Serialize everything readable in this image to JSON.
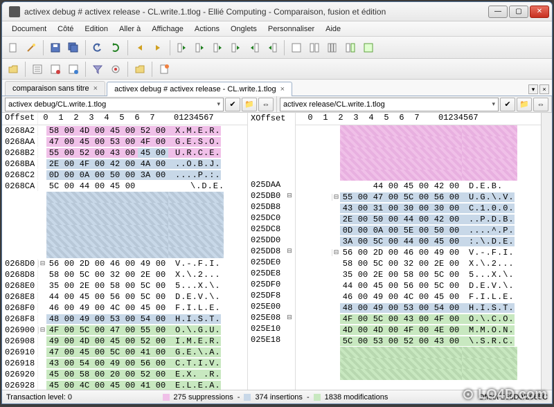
{
  "window": {
    "title": "activex debug # activex release - CL.write.1.tlog - Ellié Computing - Comparaison, fusion et édition",
    "min": "—",
    "max": "▢",
    "close": "✕"
  },
  "menu": [
    "Document",
    "Côté",
    "Edition",
    "Aller à",
    "Affichage",
    "Actions",
    "Onglets",
    "Personnaliser",
    "Aide"
  ],
  "tabs": [
    {
      "label": "comparaison sans titre",
      "active": false
    },
    {
      "label": "activex debug # activex release - CL.write.1.tlog",
      "active": true
    }
  ],
  "files": {
    "left": "activex debug/CL.write.1.tlog",
    "right": "activex release/CL.write.1.tlog"
  },
  "header_bytes": [
    "0",
    "1",
    "2",
    "3",
    "4",
    "5",
    "6",
    "7"
  ],
  "header_ascii": "01234567",
  "header_offset": "Offset",
  "header_xoffset": "XOffset",
  "status": {
    "transaction": "Transaction level: 0",
    "supp": "275 suppressions",
    "ins": "374 insertions",
    "mod": "1838 modifications",
    "offset": "Offset 268D0/2065C"
  },
  "left_rows": [
    {
      "ofs": "0268A2",
      "b": [
        "58",
        "00",
        "4D",
        "00",
        "45",
        "00",
        "52",
        "00"
      ],
      "a": "X.M.E.R.",
      "cls": "bg-pink"
    },
    {
      "ofs": "0268AA",
      "b": [
        "47",
        "00",
        "45",
        "00",
        "53",
        "00",
        "4F",
        "00"
      ],
      "a": "G.E.S.O.",
      "cls": "bg-pink"
    },
    {
      "ofs": "0268B2",
      "b": [
        "55",
        "00",
        "52",
        "00",
        "43",
        "00",
        "45",
        "00"
      ],
      "a": "U.R.C.E.",
      "cls": "bg-pink",
      "partial_blue": true
    },
    {
      "ofs": "0268BA",
      "b": [
        "2E",
        "00",
        "4F",
        "00",
        "42",
        "00",
        "4A",
        "00"
      ],
      "a": "..O.B.J.",
      "cls": "bg-blue"
    },
    {
      "ofs": "0268C2",
      "b": [
        "0D",
        "00",
        "0A",
        "00",
        "50",
        "00",
        "3A",
        "00"
      ],
      "a": "....P.:.",
      "cls": "bg-blue"
    },
    {
      "ofs": "0268CA",
      "b": [
        "5C",
        "00",
        "44",
        "00",
        "45",
        "00",
        "",
        "",
        ""
      ],
      "a": "\\.D.E.",
      "cls": ""
    },
    {
      "ofs": "0268D0",
      "b": [
        "56",
        "00",
        "2D",
        "00",
        "46",
        "00",
        "49",
        "00"
      ],
      "a": "V.-.F.I.",
      "cls": "",
      "marker": "⊟"
    },
    {
      "ofs": "0268D8",
      "b": [
        "58",
        "00",
        "5C",
        "00",
        "32",
        "00",
        "2E",
        "00"
      ],
      "a": "X.\\.2...",
      "cls": ""
    },
    {
      "ofs": "0268E0",
      "b": [
        "35",
        "00",
        "2E",
        "00",
        "58",
        "00",
        "5C",
        "00"
      ],
      "a": "5...X.\\.",
      "cls": ""
    },
    {
      "ofs": "0268E8",
      "b": [
        "44",
        "00",
        "45",
        "00",
        "56",
        "00",
        "5C",
        "00"
      ],
      "a": "D.E.V.\\.",
      "cls": ""
    },
    {
      "ofs": "0268F0",
      "b": [
        "46",
        "00",
        "49",
        "00",
        "4C",
        "00",
        "45",
        "00"
      ],
      "a": "F.I.L.E.",
      "cls": ""
    },
    {
      "ofs": "0268F8",
      "b": [
        "48",
        "00",
        "49",
        "00",
        "53",
        "00",
        "54",
        "00"
      ],
      "a": "H.I.S.T.",
      "cls": "bg-blue"
    },
    {
      "ofs": "026900",
      "b": [
        "4F",
        "00",
        "5C",
        "00",
        "47",
        "00",
        "55",
        "00"
      ],
      "a": "O.\\.G.U.",
      "cls": "bg-green",
      "marker": "⊟"
    },
    {
      "ofs": "026908",
      "b": [
        "49",
        "00",
        "4D",
        "00",
        "45",
        "00",
        "52",
        "00"
      ],
      "a": "I.M.E.R.",
      "cls": "bg-green"
    },
    {
      "ofs": "026910",
      "b": [
        "47",
        "00",
        "45",
        "00",
        "5C",
        "00",
        "41",
        "00"
      ],
      "a": "G.E.\\.A.",
      "cls": "bg-green"
    },
    {
      "ofs": "026918",
      "b": [
        "43",
        "00",
        "54",
        "00",
        "49",
        "00",
        "56",
        "00"
      ],
      "a": "C.T.I.V.",
      "cls": "bg-green"
    },
    {
      "ofs": "026920",
      "b": [
        "45",
        "00",
        "58",
        "00",
        "20",
        "00",
        "52",
        "00"
      ],
      "a": "E.X. .R.",
      "cls": "bg-green"
    },
    {
      "ofs": "026928",
      "b": [
        "45",
        "00",
        "4C",
        "00",
        "45",
        "00",
        "41",
        "00"
      ],
      "a": "E.L.E.A.",
      "cls": "bg-green"
    }
  ],
  "left_gap": {
    "count": 6,
    "cls": "bg-bluehatch"
  },
  "mid_rows": [
    "025DAA",
    "025DB0",
    "025DB8",
    "025DC0",
    "025DC8",
    "025DD0",
    "025DD8",
    "025DE0",
    "025DE8",
    "025DF0",
    "025DF8",
    "025E00",
    "025E08",
    "025E10",
    "025E18"
  ],
  "right_rows": [
    {
      "ofs": "",
      "b": [
        "",
        "",
        "44",
        "00",
        "45",
        "00",
        "42",
        "00"
      ],
      "a": "    D.E.B.",
      "cls": ""
    },
    {
      "ofs": "",
      "b": [
        "55",
        "00",
        "47",
        "00",
        "5C",
        "00",
        "56",
        "00"
      ],
      "a": "U.G.\\.V.",
      "cls": "bg-blue",
      "marker": "⊟"
    },
    {
      "ofs": "",
      "b": [
        "43",
        "00",
        "31",
        "00",
        "30",
        "00",
        "30",
        "00"
      ],
      "a": "C.1.0.0.",
      "cls": "bg-blue"
    },
    {
      "ofs": "",
      "b": [
        "2E",
        "00",
        "50",
        "00",
        "44",
        "00",
        "42",
        "00"
      ],
      "a": "..P.D.B.",
      "cls": "bg-blue"
    },
    {
      "ofs": "",
      "b": [
        "0D",
        "00",
        "0A",
        "00",
        "5E",
        "00",
        "50",
        "00"
      ],
      "a": "....^.P.",
      "cls": "bg-blue"
    },
    {
      "ofs": "",
      "b": [
        "3A",
        "00",
        "5C",
        "00",
        "44",
        "00",
        "45",
        "00"
      ],
      "a": ":.\\.D.E.",
      "cls": "bg-blue"
    },
    {
      "ofs": "",
      "b": [
        "56",
        "00",
        "2D",
        "00",
        "46",
        "00",
        "49",
        "00"
      ],
      "a": "V.-.F.I.",
      "cls": "",
      "marker": "⊟"
    },
    {
      "ofs": "",
      "b": [
        "58",
        "00",
        "5C",
        "00",
        "32",
        "00",
        "2E",
        "00"
      ],
      "a": "X.\\.2...",
      "cls": ""
    },
    {
      "ofs": "",
      "b": [
        "35",
        "00",
        "2E",
        "00",
        "58",
        "00",
        "5C",
        "00"
      ],
      "a": "5...X.\\.",
      "cls": ""
    },
    {
      "ofs": "",
      "b": [
        "44",
        "00",
        "45",
        "00",
        "56",
        "00",
        "5C",
        "00"
      ],
      "a": "D.E.V.\\.",
      "cls": ""
    },
    {
      "ofs": "",
      "b": [
        "46",
        "00",
        "49",
        "00",
        "4C",
        "00",
        "45",
        "00"
      ],
      "a": "F.I.L.E.",
      "cls": ""
    },
    {
      "ofs": "",
      "b": [
        "48",
        "00",
        "49",
        "00",
        "53",
        "00",
        "54",
        "00"
      ],
      "a": "H.I.S.T.",
      "cls": "bg-blue"
    },
    {
      "ofs": "",
      "b": [
        "4F",
        "00",
        "5C",
        "00",
        "43",
        "00",
        "4F",
        "00"
      ],
      "a": "O.\\.C.O.",
      "cls": "bg-green"
    },
    {
      "ofs": "",
      "b": [
        "4D",
        "00",
        "4D",
        "00",
        "4F",
        "00",
        "4E",
        "00"
      ],
      "a": "M.M.O.N.",
      "cls": "bg-green"
    },
    {
      "ofs": "",
      "b": [
        "5C",
        "00",
        "53",
        "00",
        "52",
        "00",
        "43",
        "00"
      ],
      "a": "\\.S.R.C.",
      "cls": "bg-green"
    }
  ],
  "right_gap_top": {
    "count": 5,
    "cls": "bg-pinkhatch"
  },
  "right_gap_bot": {
    "count": 3,
    "cls": "bg-greenhatch"
  }
}
